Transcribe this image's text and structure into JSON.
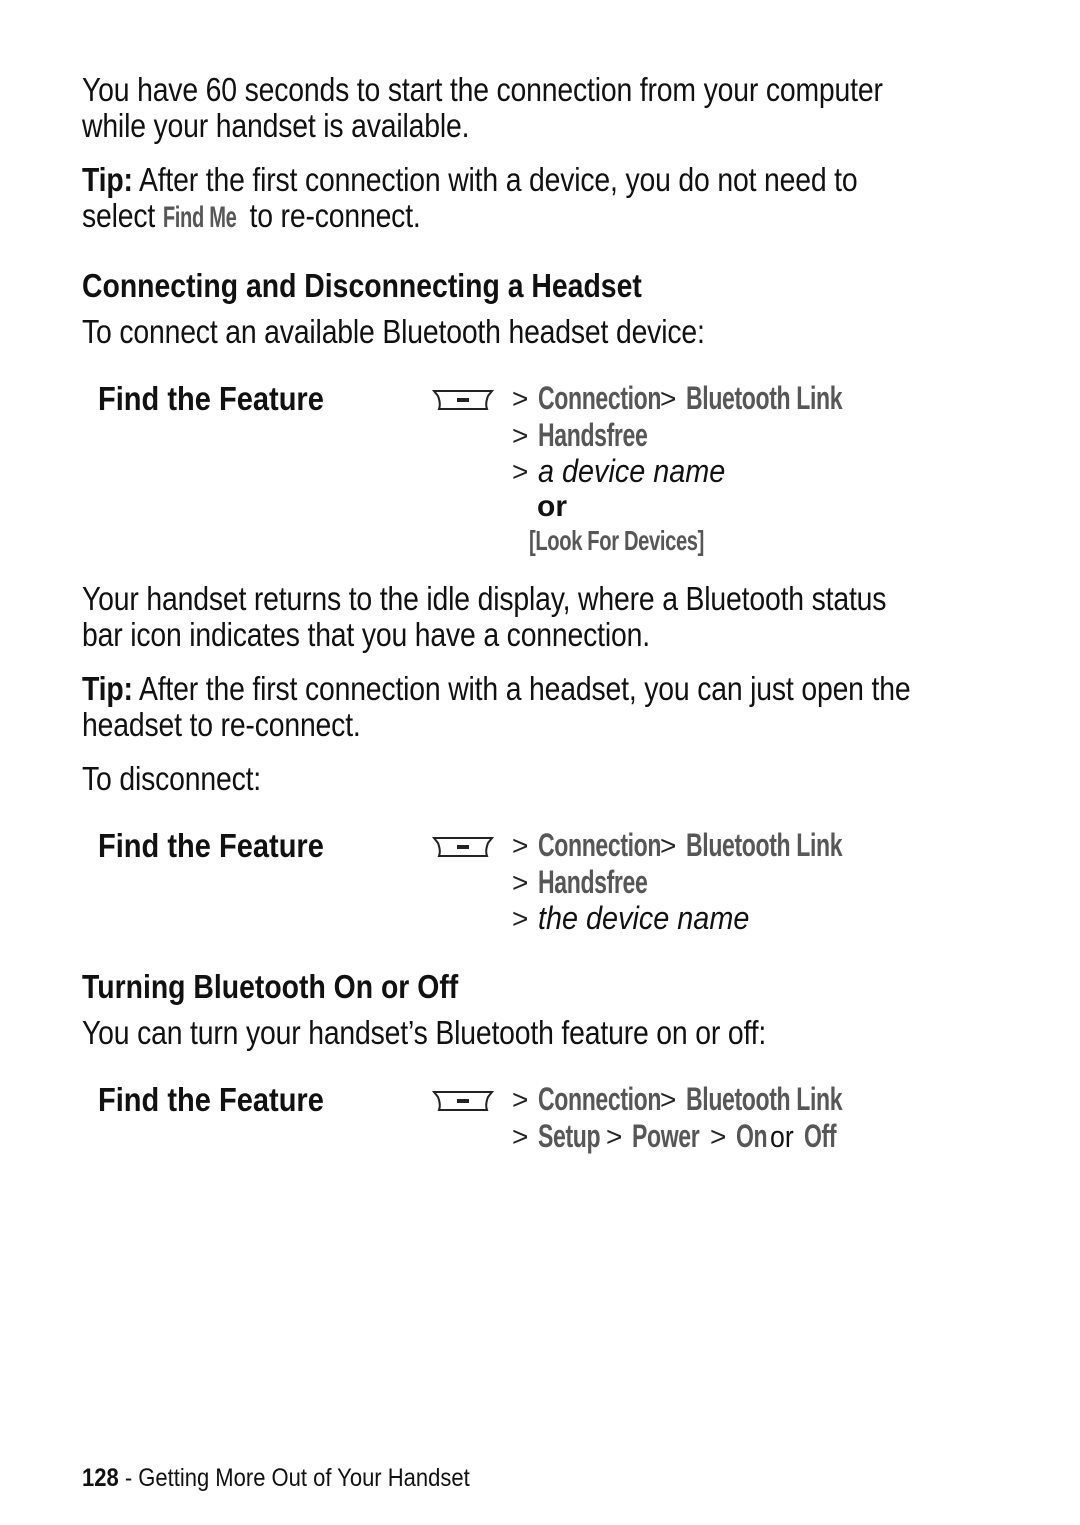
{
  "intro": {
    "line1": "You have 60 seconds to start the connection from your computer",
    "line2": "while your handset is available."
  },
  "tip1": {
    "label": "Tip:",
    "text1": " After the first connection with a device, you do not need to",
    "text2_pre": "select ",
    "menu_item": "Find Me",
    "text2_post": " to re-connect."
  },
  "section1": {
    "heading": "Connecting and Disconnecting a Headset",
    "intro": "To connect an available Bluetooth headset device:",
    "find_feature": {
      "label": "Find the Feature",
      "icon": "menu-key-icon",
      "path": [
        "Connection",
        "Bluetooth Link",
        "Handsfree"
      ],
      "italic_step": "a device name",
      "or_label": "or",
      "alt_option": "[Look For Devices]"
    },
    "para1_line1": "Your handset returns to the idle display, where a Bluetooth status",
    "para1_line2": "bar icon indicates that you have a connection.",
    "tip": {
      "label": "Tip:",
      "text1": " After the first connection with a headset, you can just open the",
      "text2": "headset to re-connect."
    },
    "disconnect_intro": "To disconnect:",
    "find_feature2": {
      "label": "Find the Feature",
      "icon": "menu-key-icon",
      "path": [
        "Connection",
        "Bluetooth Link",
        "Handsfree"
      ],
      "italic_step": "the device name"
    }
  },
  "section2": {
    "heading": "Turning Bluetooth On or Off",
    "intro": "You can turn your handset’s Bluetooth feature on or off:",
    "find_feature": {
      "label": "Find the Feature",
      "icon": "menu-key-icon",
      "path": [
        "Connection",
        "Bluetooth Link",
        "Setup",
        "Power"
      ],
      "option_on": "On",
      "or_label": "or",
      "option_off": "Off"
    }
  },
  "footer": {
    "page_number": "128",
    "separator": " - ",
    "chapter": "Getting More Out of Your Handset"
  },
  "colors": {
    "text": "#111111",
    "menu_text": "#575757"
  },
  "symbols": {
    "gt": ">"
  }
}
